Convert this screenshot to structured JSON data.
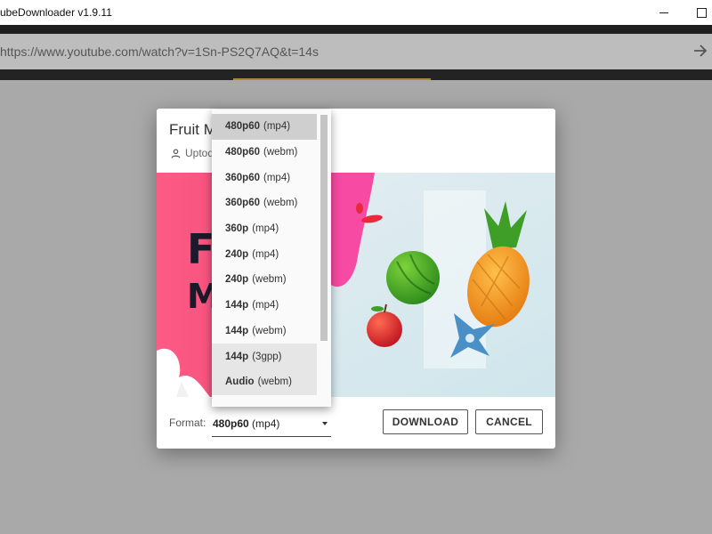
{
  "window": {
    "title": "ubeDownloader v1.9.11"
  },
  "urlbar": {
    "url": "https://www.youtube.com/watch?v=1Sn-PS2Q7AQ&t=14s"
  },
  "dialog": {
    "title": "Fruit M                          Android",
    "uploader": "Uptod"
  },
  "thumbnail": {
    "text_line1": "F",
    "text_line2": "M"
  },
  "format": {
    "label": "Format:",
    "selected_res": "480p60",
    "selected_ext": "(mp4)"
  },
  "buttons": {
    "download": "DOWNLOAD",
    "cancel": "CANCEL"
  },
  "format_options": [
    {
      "res": "480p60",
      "ext": "(mp4)"
    },
    {
      "res": "480p60",
      "ext": "(webm)"
    },
    {
      "res": "360p60",
      "ext": "(mp4)"
    },
    {
      "res": "360p60",
      "ext": "(webm)"
    },
    {
      "res": "360p",
      "ext": "(mp4)"
    },
    {
      "res": "240p",
      "ext": "(mp4)"
    },
    {
      "res": "240p",
      "ext": "(webm)"
    },
    {
      "res": "144p",
      "ext": "(mp4)"
    },
    {
      "res": "144p",
      "ext": "(webm)"
    },
    {
      "res": "144p",
      "ext": "(3gpp)"
    },
    {
      "res": "Audio",
      "ext": "(webm)"
    }
  ],
  "icons": {
    "minimize": "minimize-icon",
    "maximize": "maximize-icon",
    "go": "arrow-right-icon",
    "uploader": "person-icon"
  }
}
